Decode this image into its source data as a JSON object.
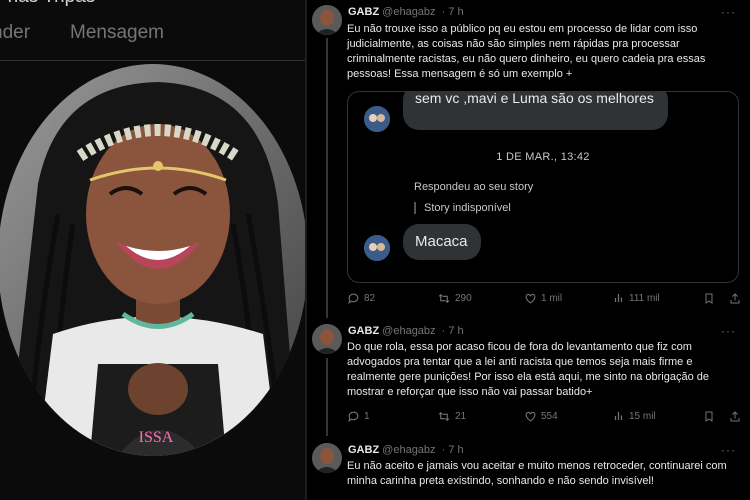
{
  "profile_panel": {
    "bio_fragment": "r nas Tripas",
    "tabs": [
      "nder",
      "Mensagem"
    ],
    "photo_shirt_text": "ISSA"
  },
  "tweets": [
    {
      "name": "GABZ",
      "handle": "@ehagabz",
      "time": "· 7 h",
      "more": "···",
      "text": "Eu não trouxe isso a público pq eu estou em processo de lidar com isso judicialmente, as coisas não são simples nem rápidas pra processar criminalmente racistas, eu não quero dinheiro, eu quero cadeia pra essas pessoas! Essa mensagem é só um exemplo +",
      "replies": "82",
      "retweets": "290",
      "likes": "1 mil",
      "views": "111 mil"
    },
    {
      "name": "GABZ",
      "handle": "@ehagabz",
      "time": "· 7 h",
      "more": "···",
      "text": "Do que rola, essa por acaso ficou de fora do levantamento que fiz com advogados pra tentar que a lei anti racista que temos seja mais firme e realmente gere punições!  Por isso ela está aqui, me sinto na obrigação de mostrar e reforçar que isso não vai passar batido+",
      "replies": "1",
      "retweets": "21",
      "likes": "554",
      "views": "15 mil"
    },
    {
      "name": "GABZ",
      "handle": "@ehagabz",
      "time": "· 7 h",
      "more": "···",
      "text": "Eu não aceito e jamais vou aceitar e muito menos retroceder, continuarei com minha carinha preta existindo, sonhando e não sendo invisível!"
    }
  ],
  "dm": {
    "top_bubble": "sem vc ,mavi e Luma são os melhores",
    "date": "1 DE MAR., 13:42",
    "replied_label": "Respondeu ao seu story",
    "story_label": "Story indisponível",
    "last_bubble": "Macaca"
  },
  "colors": {
    "background": "#000000",
    "text": "#e7e9ea",
    "muted": "#71767b",
    "border": "#2f3336",
    "bubble": "#2f3336"
  }
}
